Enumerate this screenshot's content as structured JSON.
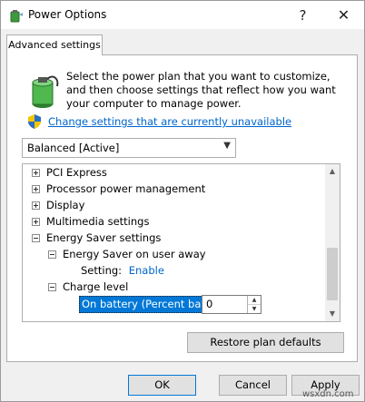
{
  "window": {
    "title": "Power Options",
    "help_glyph": "?",
    "close_glyph": "✕"
  },
  "tabs": [
    {
      "label": "Advanced settings",
      "active": true
    }
  ],
  "description": "Select the power plan that you want to customize, and then choose settings that reflect how you want your computer to manage power.",
  "change_link": "Change settings that are currently unavailable",
  "plan_select": {
    "value": "Balanced [Active]"
  },
  "tree": {
    "items": [
      {
        "label": "PCI Express",
        "expander": "+"
      },
      {
        "label": "Processor power management",
        "expander": "+"
      },
      {
        "label": "Display",
        "expander": "+"
      },
      {
        "label": "Multimedia settings",
        "expander": "+"
      },
      {
        "label": "Energy Saver settings",
        "expander": "-"
      },
      {
        "label": "Energy Saver on user away",
        "expander": "-"
      },
      {
        "label": "Setting:",
        "value": "Enable"
      },
      {
        "label": "Charge level",
        "expander": "-"
      }
    ],
    "edit": {
      "label": "On battery (Percent battery charge):",
      "value": "0"
    }
  },
  "buttons": {
    "restore": "Restore plan defaults",
    "ok": "OK",
    "cancel": "Cancel",
    "apply": "Apply"
  },
  "watermark": "wsxdn.com",
  "colors": {
    "link": "#0066cc",
    "selection": "#0078d7",
    "panel_bg": "#f0f0f0"
  },
  "icons": {
    "title": "power-options-icon",
    "battery": "battery-plug-icon",
    "shield": "uac-shield-icon"
  }
}
